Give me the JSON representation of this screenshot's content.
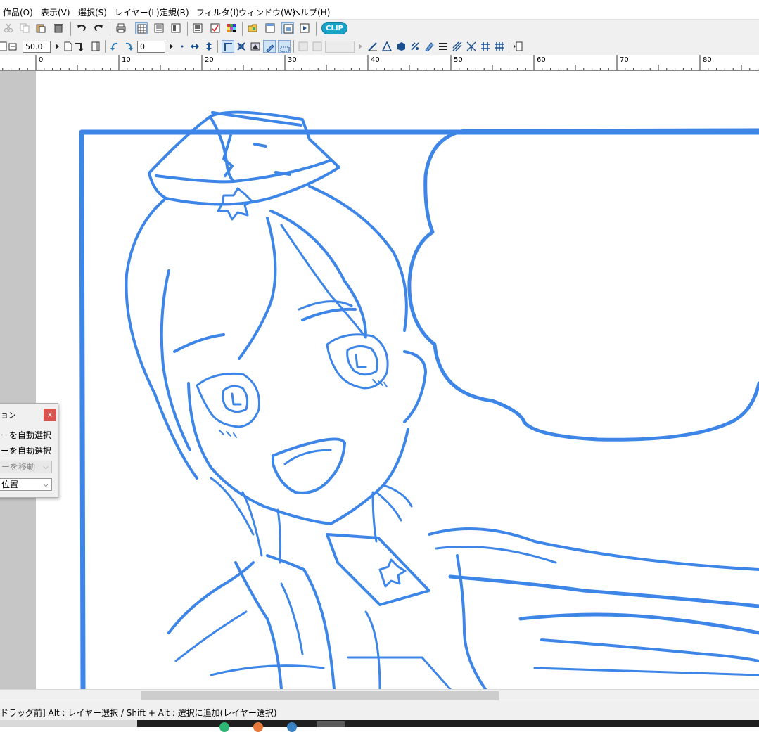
{
  "menu": [
    {
      "label": "作品(O)"
    },
    {
      "label": "表示(V)"
    },
    {
      "label": "選択(S)"
    },
    {
      "label": "レイヤー(L)"
    },
    {
      "label": "定規(R)"
    },
    {
      "label": "フィルタ(I)"
    },
    {
      "label": "ウィンドウ(W)"
    },
    {
      "label": "ヘルプ(H)"
    }
  ],
  "toolbar": {
    "logo_text": "CLIP",
    "zoom_value": "50.0",
    "rotation_value": "0"
  },
  "ruler": {
    "ticks": [
      "0",
      "10",
      "20",
      "30",
      "40",
      "50",
      "60",
      "70",
      "80"
    ]
  },
  "panel": {
    "title": "ョン",
    "close_label": "×",
    "option1": "ーを自動選択",
    "option2": "ーを自動選択",
    "select1": "ーを移動",
    "select2": "位置"
  },
  "status": {
    "text": "ドラッグ前] Alt : レイヤー選択 / Shift + Alt : 選択に追加(レイヤー選択)"
  },
  "colors": {
    "line_art": "#3d85e6",
    "gutter": "#c6c6c6",
    "toolbar_bg": "#f0f0f0"
  }
}
